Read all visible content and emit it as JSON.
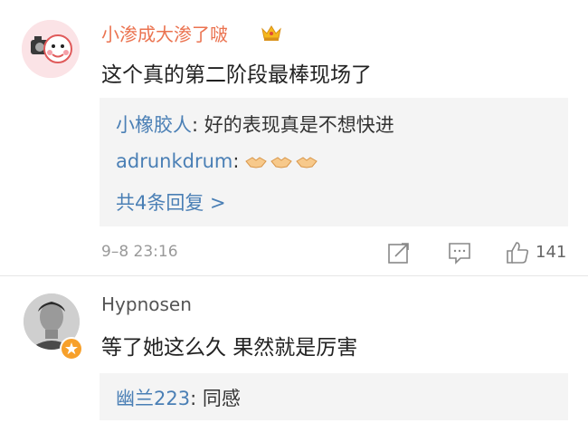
{
  "comments": [
    {
      "username": "小渗成大渗了啵",
      "text": "这个真的第二阶段最棒现场了",
      "replies": [
        {
          "name": "小橡胶人",
          "sep": ": ",
          "text": "好的表现真是不想快进"
        },
        {
          "name": "adrunkdrum",
          "sep": ": ",
          "text": ""
        }
      ],
      "more_replies": "共4条回复 >",
      "time": "9–8 23:16",
      "like_count": "141",
      "icons": [
        "camera-avatar",
        "crown-badge-icon",
        "handshake-icon",
        "share-icon",
        "comment-icon",
        "like-icon"
      ]
    },
    {
      "username": "Hypnosen",
      "text": "等了她这么久 果然就是厉害",
      "replies": [
        {
          "name": "幽兰223",
          "sep": ": ",
          "text": "同感"
        }
      ],
      "icons": [
        "user-avatar",
        "verified-badge-icon"
      ]
    }
  ],
  "colors": {
    "vip_username": "#eb7350",
    "reply_name": "#4a7fb5",
    "reply_background": "#f4f4f4",
    "meta_text": "#999999"
  }
}
